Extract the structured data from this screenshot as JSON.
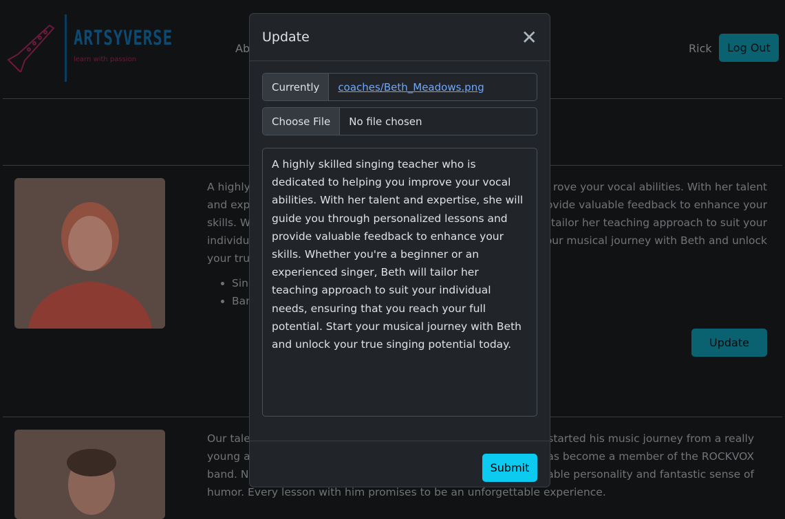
{
  "header": {
    "brand": "ARTSYVERSE",
    "tagline": "learn with passion",
    "nav_partial": "Ab",
    "user": "Rick",
    "logout": "Log Out"
  },
  "coach1": {
    "left_lines": [
      "A highly",
      "and expe",
      "skills. Wh",
      "individua",
      "your true"
    ],
    "right_lines": [
      "rove your vocal abilities. With her talent",
      "provide valuable feedback to enhance your",
      "l tailor her teaching approach to suit your",
      "our musical journey with Beth and unlock"
    ],
    "list": [
      "Sing",
      "Ban"
    ],
    "update": "Update"
  },
  "coach2": {
    "left_lines": [
      "Our taler",
      "young ag",
      "band. No"
    ],
    "right_lines": [
      "e started his music journey from a really",
      "has become a member of the ROCKVOX",
      "miable personality and fantastic sense of"
    ],
    "last_line": "humor. Every lesson with him promises to be an unforgettable experience."
  },
  "modal": {
    "title": "Update",
    "current_label": "Currently",
    "current_file": "coaches/Beth_Meadows.png",
    "choose_label": "Choose File",
    "choose_value": "No file chosen",
    "description": "A highly skilled singing teacher who is dedicated to helping you improve your vocal abilities. With her talent and expertise, she will guide you through personalized lessons and provide valuable feedback to enhance your skills. Whether you're a beginner or an experienced singer, Beth will tailor her teaching approach to suit your individual needs, ensuring that you reach your full potential. Start your musical journey with Beth and unlock your true singing potential today.",
    "submit": "Submit"
  },
  "colors": {
    "accent": "#0dcaf0",
    "brand": "#0d4a72",
    "logo": "#6b1a3a"
  }
}
